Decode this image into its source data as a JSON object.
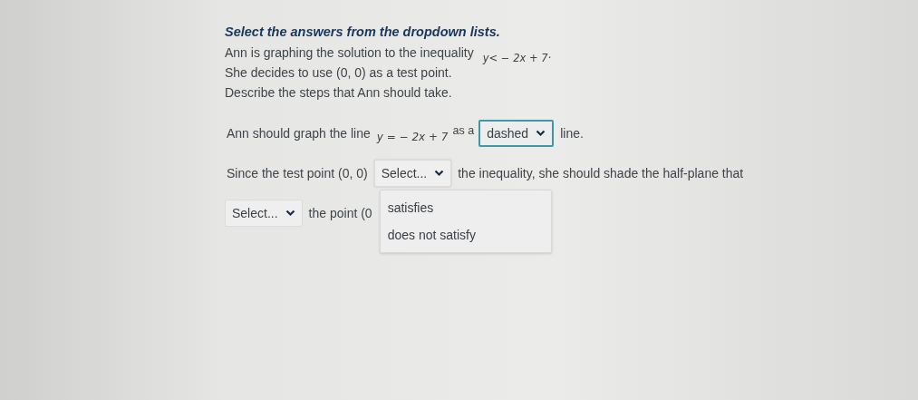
{
  "instruction": "Select the answers from the dropdown lists.",
  "intro": [
    {
      "text": "Ann is graphing the solution to the inequality",
      "math": "y< − 2x + 7·"
    },
    {
      "text": "She decides to use (0, 0) as a test point."
    },
    {
      "text": "Describe the steps that Ann should take."
    }
  ],
  "statements": [
    {
      "parts": [
        {
          "kind": "text",
          "text": "Ann should graph the line"
        },
        {
          "kind": "math",
          "text": "y = − 2x + 7"
        },
        {
          "kind": "small",
          "text": "as a"
        },
        {
          "kind": "select",
          "value": "dashed",
          "focused": true,
          "open": false
        },
        {
          "kind": "text",
          "text": "line."
        }
      ]
    },
    {
      "parts": [
        {
          "kind": "text",
          "text": "Since the test point (0, 0)"
        },
        {
          "kind": "select",
          "value": "Select...",
          "focused": false,
          "open": true,
          "options": [
            {
              "label": "satisfies",
              "selected": false
            },
            {
              "label": "does not satisfy",
              "selected": false
            }
          ]
        },
        {
          "kind": "text",
          "text": "the inequality, she should shade the half-plane that"
        }
      ]
    },
    {
      "parts": [
        {
          "kind": "select",
          "value": "Select...",
          "focused": false,
          "open": false
        },
        {
          "kind": "text",
          "text": "the point (0"
        }
      ]
    }
  ]
}
